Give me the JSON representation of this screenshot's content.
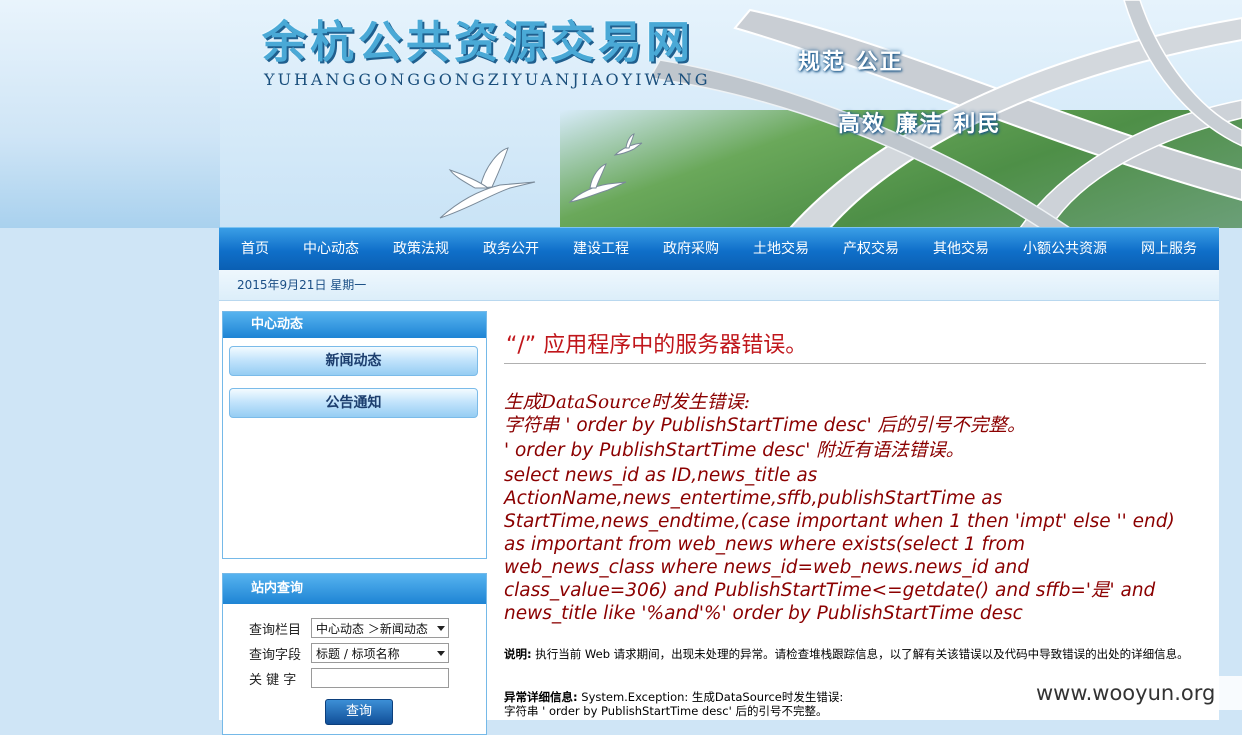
{
  "banner": {
    "title": "余杭公共资源交易网",
    "pinyin": "YUHANGGONGGONGZIYUANJIAOYIWANG",
    "slogan_line1": "规范 公正",
    "slogan_line2": "高效 廉洁 利民"
  },
  "nav": {
    "items": [
      "首页",
      "中心动态",
      "政策法规",
      "政务公开",
      "建设工程",
      "政府采购",
      "土地交易",
      "产权交易",
      "其他交易",
      "小额公共资源",
      "网上服务"
    ]
  },
  "datebar": {
    "date": "2015年9月21日  星期一"
  },
  "sidebar": {
    "center_title": "中心动态",
    "center_items": [
      "新闻动态",
      "公告通知"
    ],
    "search_title": "站内查询",
    "column_label": "查询栏目",
    "column_value": "中心动态 ＞新闻动态",
    "field_label": "查询字段",
    "field_value": "标题 / 标项名称",
    "keyword_label": "关 键 字",
    "keyword_value": "",
    "submit_label": "查询"
  },
  "error": {
    "title": "“/” 应用程序中的服务器错误。",
    "lines": [
      "生成DataSource时发生错误:",
      "字符串 ' order by PublishStartTime desc' 后的引号不完整。",
      "' order by PublishStartTime desc' 附近有语法错误。",
      "select news_id as ID,news_title as",
      "ActionName,news_entertime,sffb,publishStartTime as",
      "StartTime,news_endtime,(case important when 1 then 'impt' else '' end)",
      "as important from web_news where exists(select 1 from",
      "web_news_class where news_id=web_news.news_id and",
      "class_value=306) and PublishStartTime<=getdate() and sffb='是' and",
      "news_title like '%and'%' order by PublishStartTime desc"
    ],
    "desc_label": "说明:",
    "desc_text": " 执行当前 Web 请求期间，出现未处理的异常。请检查堆栈跟踪信息，以了解有关该错误以及代码中导致错误的出处的详细信息。",
    "detail_label": "异常详细信息:",
    "detail_text": " System.Exception: 生成DataSource时发生错误:",
    "detail_line2": "字符串 ' order by PublishStartTime desc' 后的引号不完整。"
  },
  "watermark": "www.wooyun.org"
}
